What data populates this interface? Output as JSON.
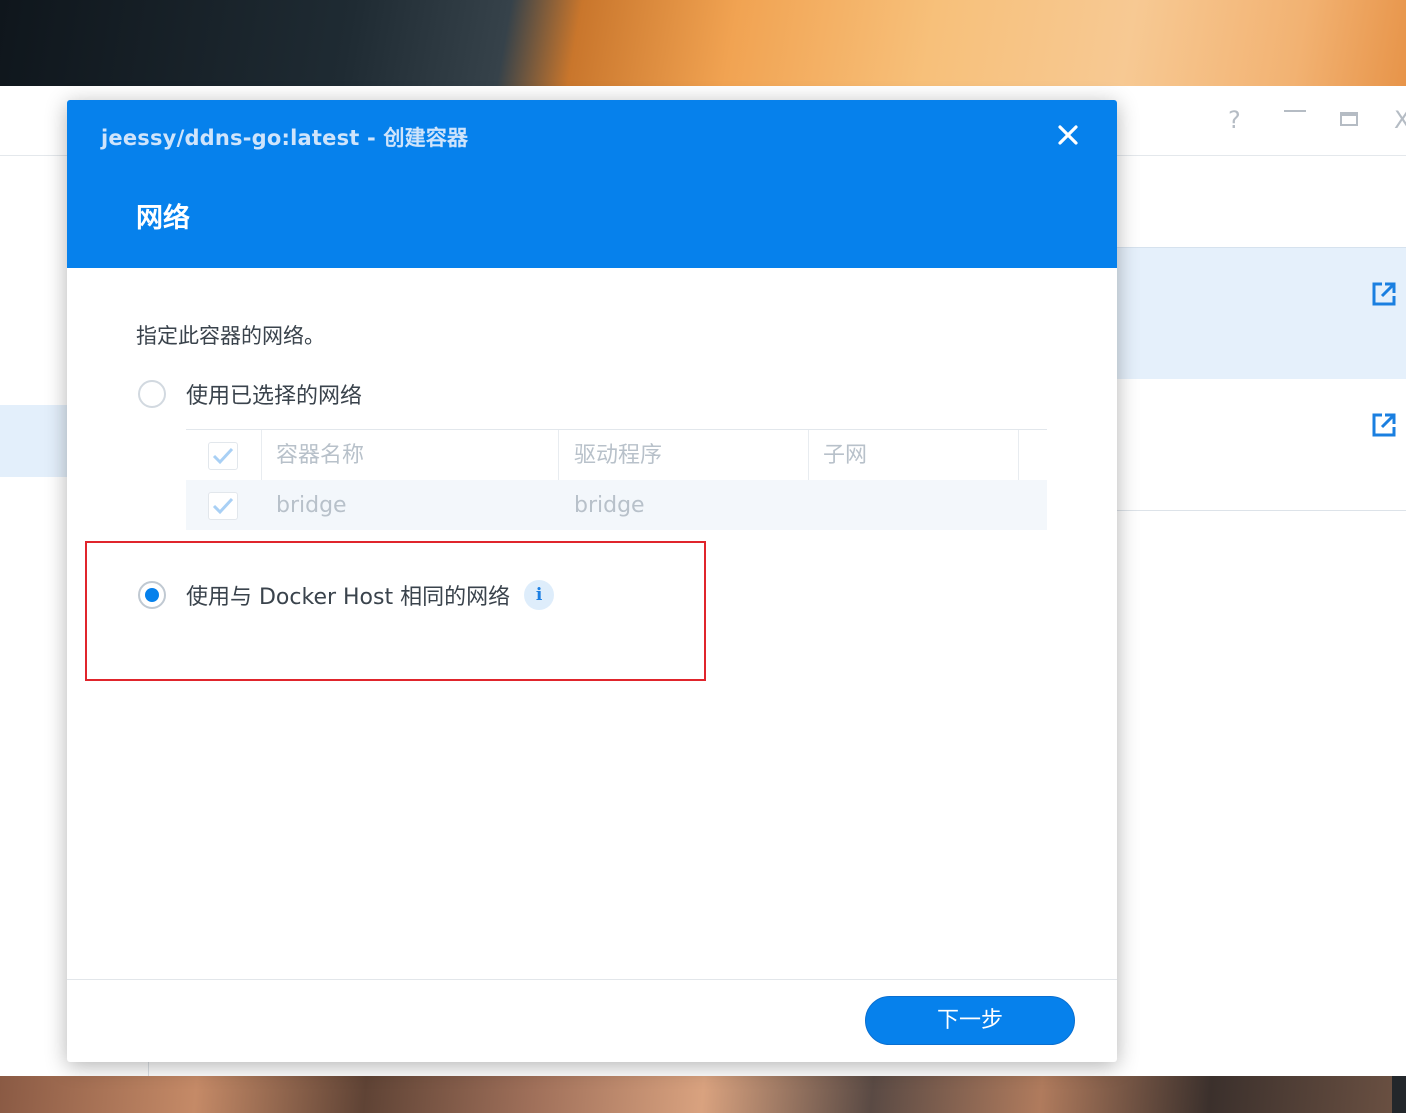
{
  "dialog": {
    "title": "jeessy/ddns-go:latest - 创建容器",
    "step_title": "网络",
    "description": "指定此容器的网络。",
    "option_selected_network": "使用已选择的网络",
    "option_host_network": "使用与 Docker Host 相同的网络",
    "selected_option": "host",
    "info_icon": "i",
    "network_table": {
      "columns": [
        "容器名称",
        "驱动程序",
        "子网"
      ],
      "rows": [
        {
          "checked": true,
          "name": "bridge",
          "driver": "bridge",
          "subnet": ""
        }
      ],
      "header_checked": true
    },
    "next_button": "下一步"
  },
  "background_window": {
    "controls": {
      "help": "?",
      "close": "X"
    }
  },
  "colors": {
    "accent": "#0681ec",
    "highlight": "#e0252c"
  },
  "icons": [
    "close-icon",
    "info-icon",
    "checkmark-icon",
    "open-external-icon",
    "help-icon",
    "minimize-icon",
    "maximize-icon"
  ]
}
